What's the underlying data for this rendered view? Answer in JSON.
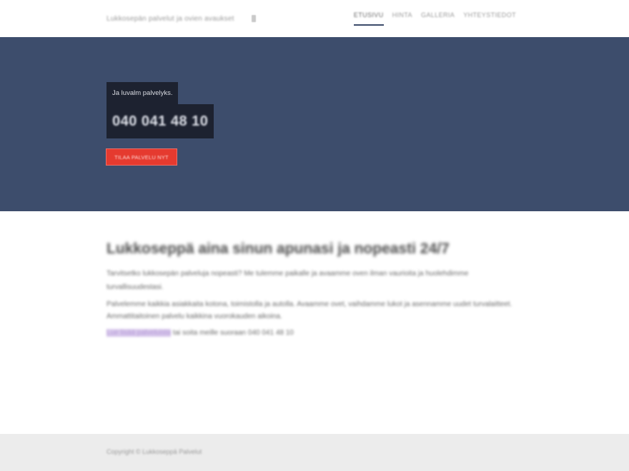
{
  "header": {
    "brand": "Lukkosepän palvelut ja ovien avaukset",
    "nav": [
      {
        "label": "Etusivu",
        "active": true
      },
      {
        "label": "Hinta",
        "active": false
      },
      {
        "label": "Galleria",
        "active": false
      },
      {
        "label": "Yhteystiedot",
        "active": false
      }
    ]
  },
  "hero": {
    "lead": "Ja luvalm palvelyks.",
    "phone": "040 041 48 10",
    "cta": "Tilaa palvelu nyt"
  },
  "content": {
    "title": "Lukkoseppä aina sinun apunasi ja nopeasti 24/7",
    "paragraph_1": "Tarvitsetko lukkosepän palveluja nopeasti? Me tulemme paikalle ja avaamme oven ilman vaurioita ja huolehdimme turvallisuudestasi.",
    "paragraph_2": "Palvelemme kaikkia asiakkaita kotona, toimistolla ja autolla. Avaamme ovet, vaihdamme lukot ja asennamme uudet turvalaitteet. Ammattitaitoinen palvelu kaikkina vuorokauden aikoina.",
    "link_text": "Lue lisää palveluista",
    "link_suffix": "tai soita meille suoraan 040 041 48 10"
  },
  "footer": {
    "text": "Copyright © Lukkoseppä Palvelut"
  },
  "colors": {
    "hero_bg": "#3d4d6c",
    "card_bg": "#1d2230",
    "cta_bg": "#e53a2f",
    "footer_bg": "#ececec"
  }
}
